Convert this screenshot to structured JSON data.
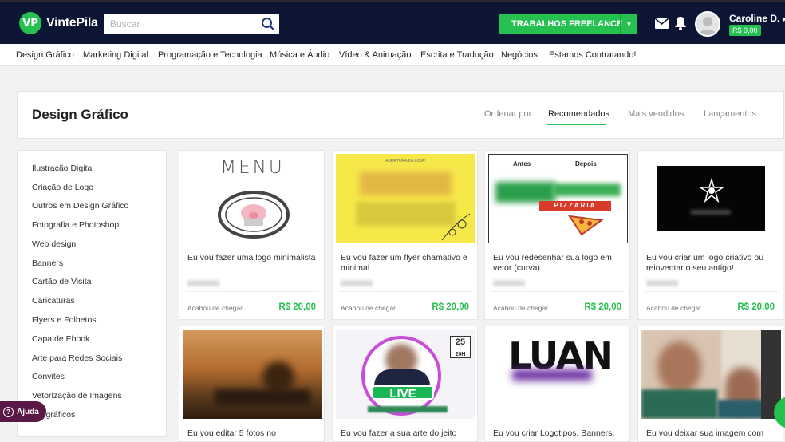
{
  "header": {
    "logo_mark": "VP",
    "logo_text": "VintePila",
    "search_placeholder": "Buscar",
    "freelance_button": "TRABALHOS FREELANCE",
    "user_name": "Caroline D.",
    "balance": "R$ 0,00"
  },
  "nav": {
    "items": [
      "Design Gráfico",
      "Marketing Digital",
      "Programação e Tecnologia",
      "Música e Áudio",
      "Vídeo & Animação",
      "Escrita e Tradução",
      "Negócios",
      "Estamos Contratando!"
    ]
  },
  "page": {
    "title": "Design Gráfico",
    "sort_label": "Ordenar por:",
    "sort_tabs": [
      "Recomendados",
      "Mais vendidos",
      "Lançamentos"
    ],
    "active_sort": "Recomendados"
  },
  "sidebar": {
    "items": [
      "Ilustração Digital",
      "Criação de Logo",
      "Outros em Design Gráfico",
      "Fotografia e Photoshop",
      "Web design",
      "Banners",
      "Cartão de Visita",
      "Caricaturas",
      "Flyers e Folhetos",
      "Capa de Ebook",
      "Arte para Redes Sociais",
      "Convites",
      "Vetorização de Imagens",
      "Infográficos"
    ]
  },
  "cards": [
    {
      "title": "Eu vou fazer uma logo minimalista",
      "badge": "Acabou de chegar",
      "price": "R$ 20,00",
      "thumb_text": "MENU"
    },
    {
      "title": "Eu vou fazer um flyer chamativo e minimal",
      "badge": "Acabou de chegar",
      "price": "R$ 20,00",
      "thumb_text": "ABERTURA DA LOJA!"
    },
    {
      "title": "Eu vou redesenhar sua logo em vetor (curva)",
      "badge": "Acabou de chegar",
      "price": "R$ 20,00",
      "thumb_text": "PIZZARIA",
      "thumb_before": "Antes",
      "thumb_after": "Depois"
    },
    {
      "title": "Eu vou criar um logo criativo ou reinventar o seu antigo!",
      "badge": "Acabou de chegar",
      "price": "R$ 20,00"
    },
    {
      "title": "Eu vou editar 5 fotos no"
    },
    {
      "title": "Eu vou fazer a sua arte do jeito",
      "thumb_text": "LIVE",
      "thumb_date": "25",
      "thumb_time": "20H"
    },
    {
      "title": "Eu vou criar Logotipos, Banners,",
      "thumb_text": "LUAN"
    },
    {
      "title": "Eu vou deixar sua imagem com"
    }
  ],
  "help": {
    "label": "Ajuda"
  },
  "colors": {
    "brand_green": "#25c04f",
    "header_bg": "#0c1533",
    "help_bg": "#5a1846"
  }
}
